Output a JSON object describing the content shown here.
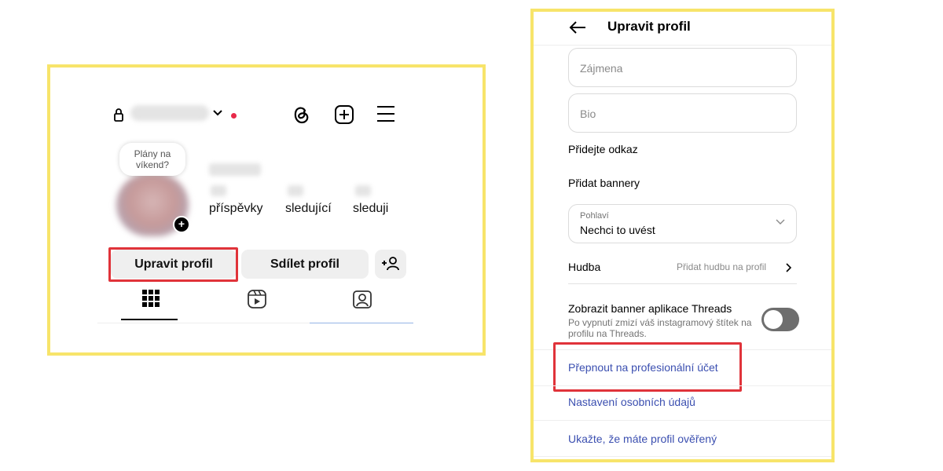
{
  "profile_screen": {
    "story_note": {
      "line1": "Plány na",
      "line2": "víkend?"
    },
    "stats": [
      {
        "label": "příspěvky"
      },
      {
        "label": "sledující"
      },
      {
        "label": "sleduji"
      }
    ],
    "buttons": {
      "edit_profile": "Upravit profil",
      "share_profile": "Sdílet profil"
    },
    "icons": [
      "lock-icon",
      "chevron-down-icon",
      "threads-icon",
      "new-post-icon",
      "menu-icon",
      "add-person-icon",
      "grid-icon",
      "reels-icon",
      "tagged-icon"
    ],
    "colors": {
      "notification_dot": "#e8294a",
      "highlight": "#e0333a",
      "frame": "#f7e46a"
    }
  },
  "edit_profile_screen": {
    "title": "Upravit profil",
    "fields": {
      "pronouns_placeholder": "Zájmena",
      "bio_placeholder": "Bio"
    },
    "add_link": "Přidejte odkaz",
    "add_banners": "Přidat bannery",
    "gender": {
      "label": "Pohlaví",
      "value": "Nechci to uvést"
    },
    "music": {
      "label": "Hudba",
      "hint": "Přidat hudbu na profil"
    },
    "threads_banner": {
      "title": "Zobrazit banner aplikace Threads",
      "description": "Po vypnutí zmizí váš instagramový štítek na profilu na Threads.",
      "enabled": false
    },
    "links": {
      "switch_pro": "Přepnout na profesionální účet",
      "personal_info": "Nastavení osobních údajů",
      "verified": "Ukažte, že máte profil ověřený"
    },
    "colors": {
      "link": "#3b4fb0",
      "highlight": "#e0333a"
    }
  }
}
